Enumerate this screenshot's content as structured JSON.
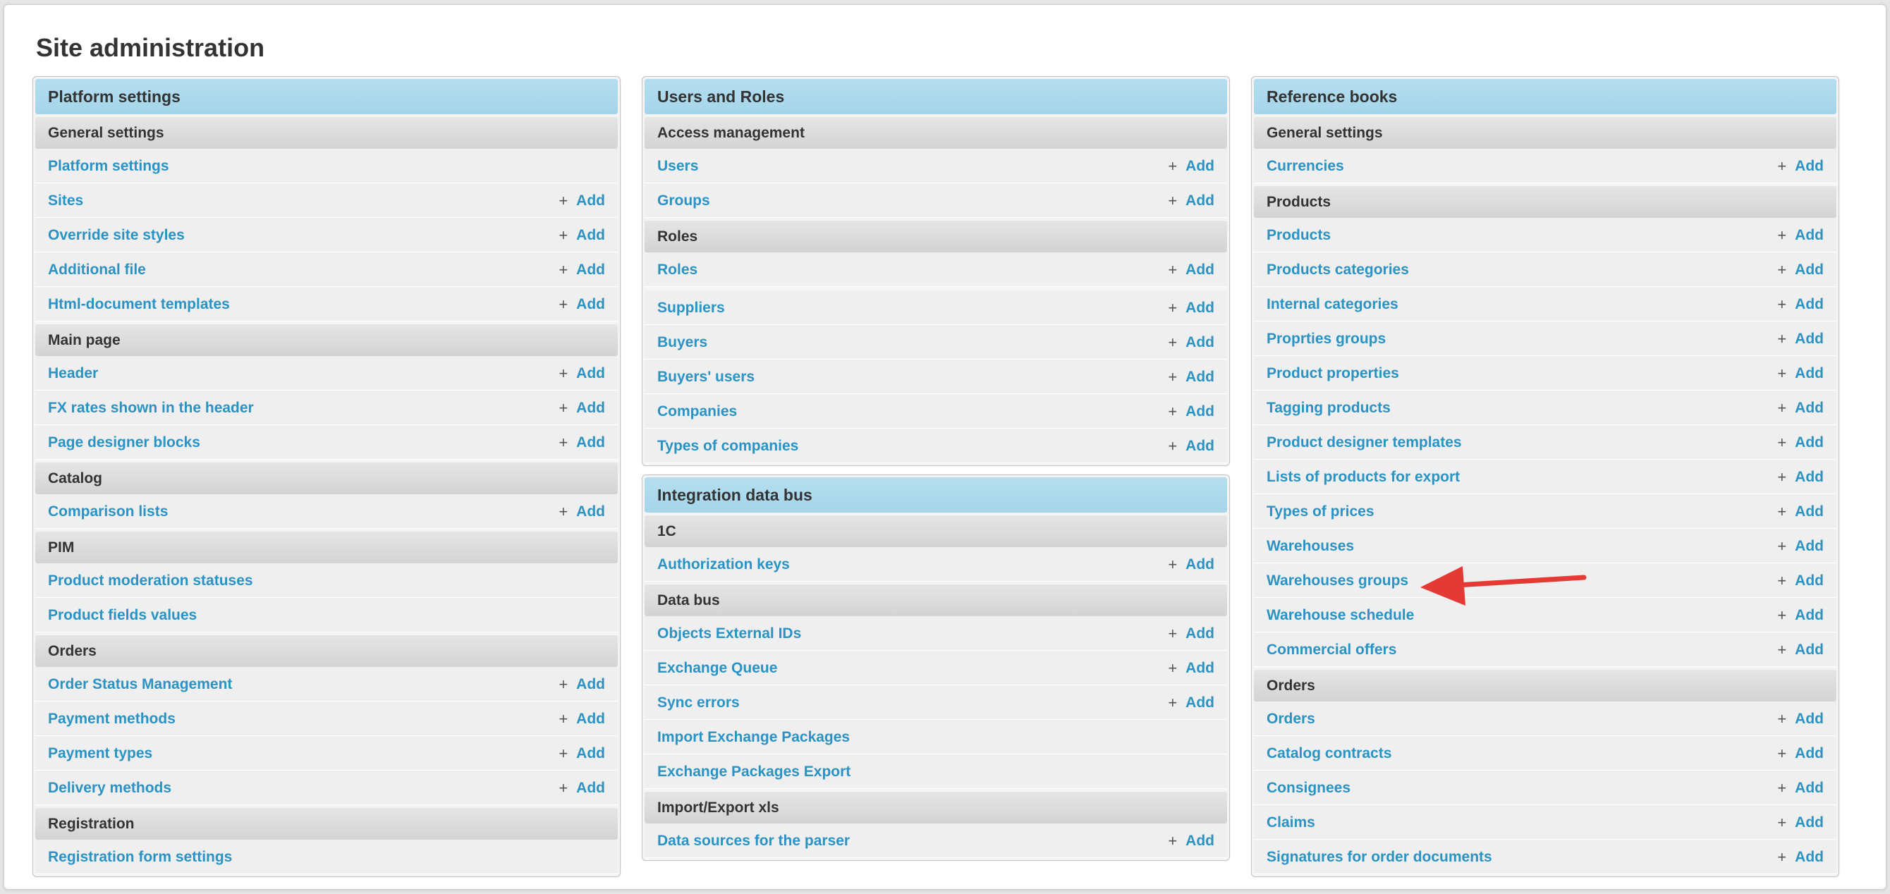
{
  "page": {
    "title": "Site administration"
  },
  "common": {
    "add_label": "Add"
  },
  "colors": {
    "accent_link": "#2a93c4",
    "panel_header": "#aad7ec",
    "section_header": "#d9d9d9",
    "arrow": "#e53935"
  },
  "platform": {
    "title": "Platform settings",
    "general": {
      "title": "General settings",
      "items": [
        "Platform settings",
        "Sites",
        "Override site styles",
        "Additional file",
        "Html-document templates"
      ]
    },
    "main_page": {
      "title": "Main page",
      "items": [
        "Header",
        "FX rates shown in the header",
        "Page designer blocks"
      ]
    },
    "catalog": {
      "title": "Catalog",
      "items": [
        "Comparison lists"
      ]
    },
    "pim": {
      "title": "PIM",
      "items": [
        "Product moderation statuses",
        "Product fields values"
      ]
    },
    "orders": {
      "title": "Orders",
      "items": [
        "Order Status Management",
        "Payment methods",
        "Payment types",
        "Delivery methods"
      ]
    },
    "registration": {
      "title": "Registration",
      "items": [
        "Registration form settings"
      ]
    }
  },
  "users_roles": {
    "title": "Users and Roles",
    "access": {
      "title": "Access management",
      "items": [
        "Users",
        "Groups"
      ]
    },
    "roles": {
      "title": "Roles",
      "items": [
        "Roles"
      ]
    },
    "other": {
      "items": [
        "Suppliers",
        "Buyers",
        "Buyers' users",
        "Companies",
        "Types of companies"
      ]
    }
  },
  "integration": {
    "title": "Integration data bus",
    "onec": {
      "title": "1C",
      "items": [
        "Authorization keys"
      ]
    },
    "databus": {
      "title": "Data bus",
      "items": [
        "Objects External IDs",
        "Exchange Queue",
        "Sync errors",
        "Import Exchange Packages",
        "Exchange Packages Export"
      ]
    },
    "xls": {
      "title": "Import/Export xls",
      "items": [
        "Data sources for the parser"
      ]
    }
  },
  "reference": {
    "title": "Reference books",
    "general": {
      "title": "General settings",
      "items": [
        "Currencies"
      ]
    },
    "products": {
      "title": "Products",
      "items": [
        "Products",
        "Products categories",
        "Internal categories",
        "Proprties groups",
        "Product properties",
        "Tagging products",
        "Product designer templates",
        "Lists of products for export",
        "Types of prices",
        "Warehouses",
        "Warehouses groups",
        "Warehouse schedule",
        "Commercial offers"
      ]
    },
    "orders": {
      "title": "Orders",
      "items": [
        "Orders",
        "Catalog contracts",
        "Consignees",
        "Claims",
        "Signatures for order documents"
      ]
    }
  }
}
